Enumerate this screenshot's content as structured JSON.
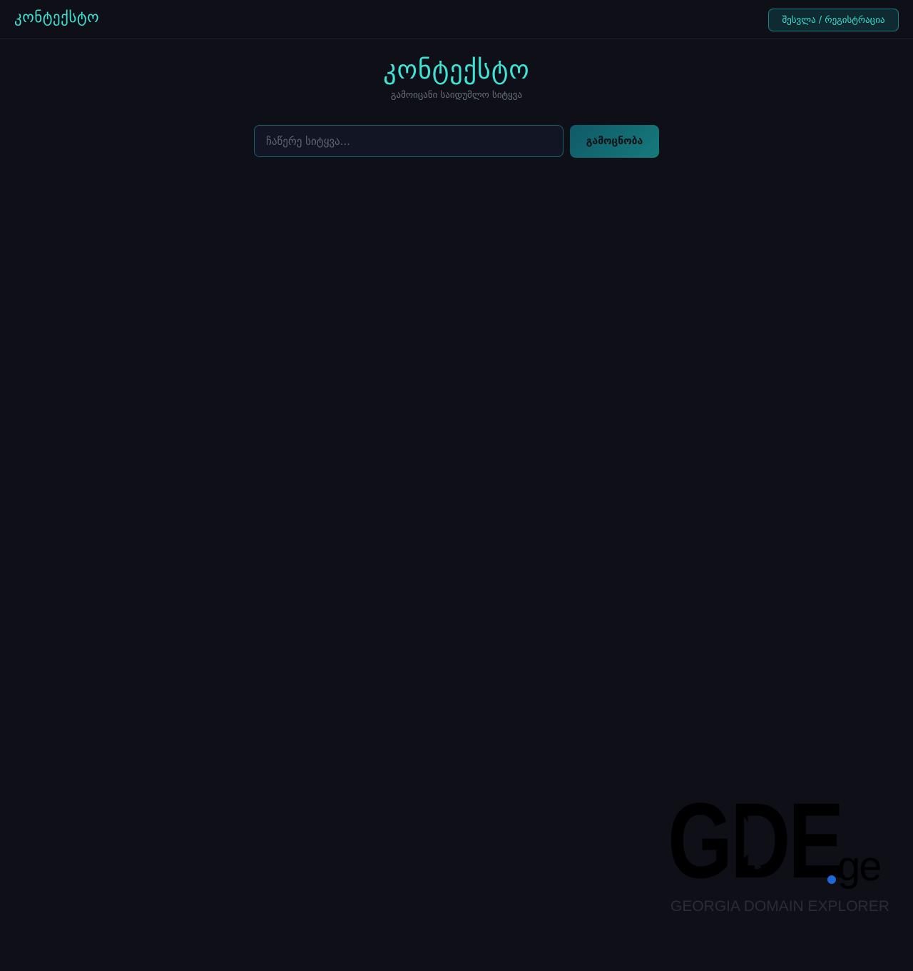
{
  "header": {
    "brand": "კონტექსტო",
    "login_label": "შესვლა / რეგისტრაცია"
  },
  "hero": {
    "title": "კონტექსტო",
    "subtitle": "გამოიცანი საიდუმლო სიტყვა"
  },
  "guess": {
    "placeholder": "ჩაწერე სიტყვა...",
    "value": "",
    "button_label": "გამოცნობა"
  },
  "watermark": {
    "letters": "GDE",
    "tld": "ge",
    "tagline": "GEORGIA DOMAIN EXPLORER"
  },
  "colors": {
    "background": "#0e0f17",
    "accent": "#3ee3d6",
    "watermark_dot": "#1f66d6"
  }
}
